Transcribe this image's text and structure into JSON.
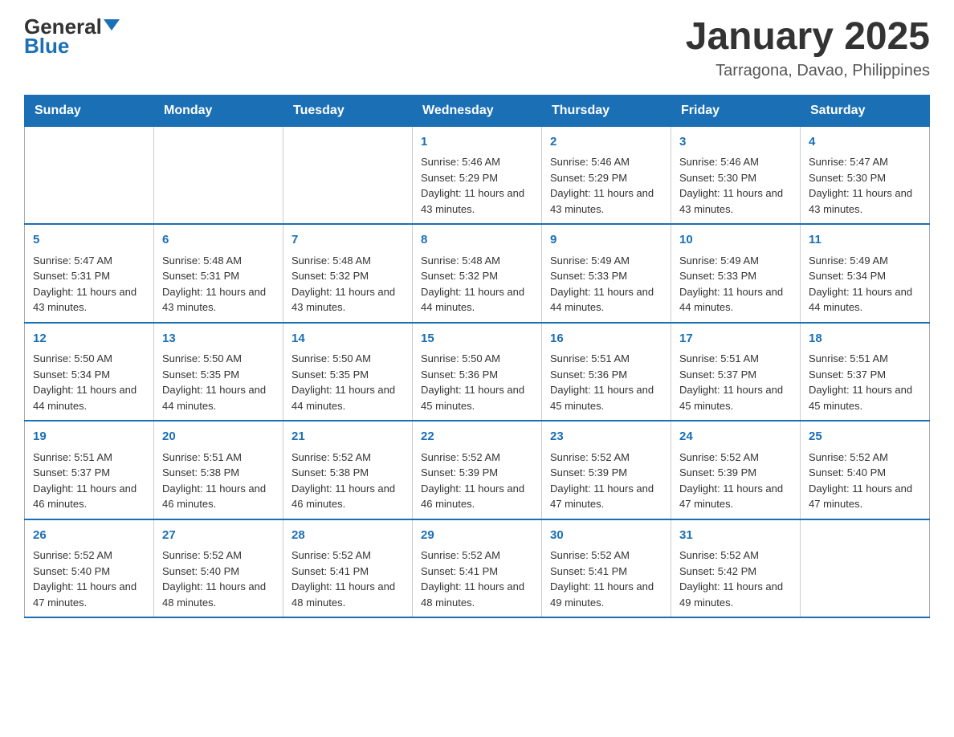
{
  "header": {
    "logo_general": "General",
    "logo_blue": "Blue",
    "main_title": "January 2025",
    "subtitle": "Tarragona, Davao, Philippines"
  },
  "calendar": {
    "days_of_week": [
      "Sunday",
      "Monday",
      "Tuesday",
      "Wednesday",
      "Thursday",
      "Friday",
      "Saturday"
    ],
    "weeks": [
      [
        {
          "day": "",
          "info": ""
        },
        {
          "day": "",
          "info": ""
        },
        {
          "day": "",
          "info": ""
        },
        {
          "day": "1",
          "info": "Sunrise: 5:46 AM\nSunset: 5:29 PM\nDaylight: 11 hours and 43 minutes."
        },
        {
          "day": "2",
          "info": "Sunrise: 5:46 AM\nSunset: 5:29 PM\nDaylight: 11 hours and 43 minutes."
        },
        {
          "day": "3",
          "info": "Sunrise: 5:46 AM\nSunset: 5:30 PM\nDaylight: 11 hours and 43 minutes."
        },
        {
          "day": "4",
          "info": "Sunrise: 5:47 AM\nSunset: 5:30 PM\nDaylight: 11 hours and 43 minutes."
        }
      ],
      [
        {
          "day": "5",
          "info": "Sunrise: 5:47 AM\nSunset: 5:31 PM\nDaylight: 11 hours and 43 minutes."
        },
        {
          "day": "6",
          "info": "Sunrise: 5:48 AM\nSunset: 5:31 PM\nDaylight: 11 hours and 43 minutes."
        },
        {
          "day": "7",
          "info": "Sunrise: 5:48 AM\nSunset: 5:32 PM\nDaylight: 11 hours and 43 minutes."
        },
        {
          "day": "8",
          "info": "Sunrise: 5:48 AM\nSunset: 5:32 PM\nDaylight: 11 hours and 44 minutes."
        },
        {
          "day": "9",
          "info": "Sunrise: 5:49 AM\nSunset: 5:33 PM\nDaylight: 11 hours and 44 minutes."
        },
        {
          "day": "10",
          "info": "Sunrise: 5:49 AM\nSunset: 5:33 PM\nDaylight: 11 hours and 44 minutes."
        },
        {
          "day": "11",
          "info": "Sunrise: 5:49 AM\nSunset: 5:34 PM\nDaylight: 11 hours and 44 minutes."
        }
      ],
      [
        {
          "day": "12",
          "info": "Sunrise: 5:50 AM\nSunset: 5:34 PM\nDaylight: 11 hours and 44 minutes."
        },
        {
          "day": "13",
          "info": "Sunrise: 5:50 AM\nSunset: 5:35 PM\nDaylight: 11 hours and 44 minutes."
        },
        {
          "day": "14",
          "info": "Sunrise: 5:50 AM\nSunset: 5:35 PM\nDaylight: 11 hours and 44 minutes."
        },
        {
          "day": "15",
          "info": "Sunrise: 5:50 AM\nSunset: 5:36 PM\nDaylight: 11 hours and 45 minutes."
        },
        {
          "day": "16",
          "info": "Sunrise: 5:51 AM\nSunset: 5:36 PM\nDaylight: 11 hours and 45 minutes."
        },
        {
          "day": "17",
          "info": "Sunrise: 5:51 AM\nSunset: 5:37 PM\nDaylight: 11 hours and 45 minutes."
        },
        {
          "day": "18",
          "info": "Sunrise: 5:51 AM\nSunset: 5:37 PM\nDaylight: 11 hours and 45 minutes."
        }
      ],
      [
        {
          "day": "19",
          "info": "Sunrise: 5:51 AM\nSunset: 5:37 PM\nDaylight: 11 hours and 46 minutes."
        },
        {
          "day": "20",
          "info": "Sunrise: 5:51 AM\nSunset: 5:38 PM\nDaylight: 11 hours and 46 minutes."
        },
        {
          "day": "21",
          "info": "Sunrise: 5:52 AM\nSunset: 5:38 PM\nDaylight: 11 hours and 46 minutes."
        },
        {
          "day": "22",
          "info": "Sunrise: 5:52 AM\nSunset: 5:39 PM\nDaylight: 11 hours and 46 minutes."
        },
        {
          "day": "23",
          "info": "Sunrise: 5:52 AM\nSunset: 5:39 PM\nDaylight: 11 hours and 47 minutes."
        },
        {
          "day": "24",
          "info": "Sunrise: 5:52 AM\nSunset: 5:39 PM\nDaylight: 11 hours and 47 minutes."
        },
        {
          "day": "25",
          "info": "Sunrise: 5:52 AM\nSunset: 5:40 PM\nDaylight: 11 hours and 47 minutes."
        }
      ],
      [
        {
          "day": "26",
          "info": "Sunrise: 5:52 AM\nSunset: 5:40 PM\nDaylight: 11 hours and 47 minutes."
        },
        {
          "day": "27",
          "info": "Sunrise: 5:52 AM\nSunset: 5:40 PM\nDaylight: 11 hours and 48 minutes."
        },
        {
          "day": "28",
          "info": "Sunrise: 5:52 AM\nSunset: 5:41 PM\nDaylight: 11 hours and 48 minutes."
        },
        {
          "day": "29",
          "info": "Sunrise: 5:52 AM\nSunset: 5:41 PM\nDaylight: 11 hours and 48 minutes."
        },
        {
          "day": "30",
          "info": "Sunrise: 5:52 AM\nSunset: 5:41 PM\nDaylight: 11 hours and 49 minutes."
        },
        {
          "day": "31",
          "info": "Sunrise: 5:52 AM\nSunset: 5:42 PM\nDaylight: 11 hours and 49 minutes."
        },
        {
          "day": "",
          "info": ""
        }
      ]
    ]
  }
}
